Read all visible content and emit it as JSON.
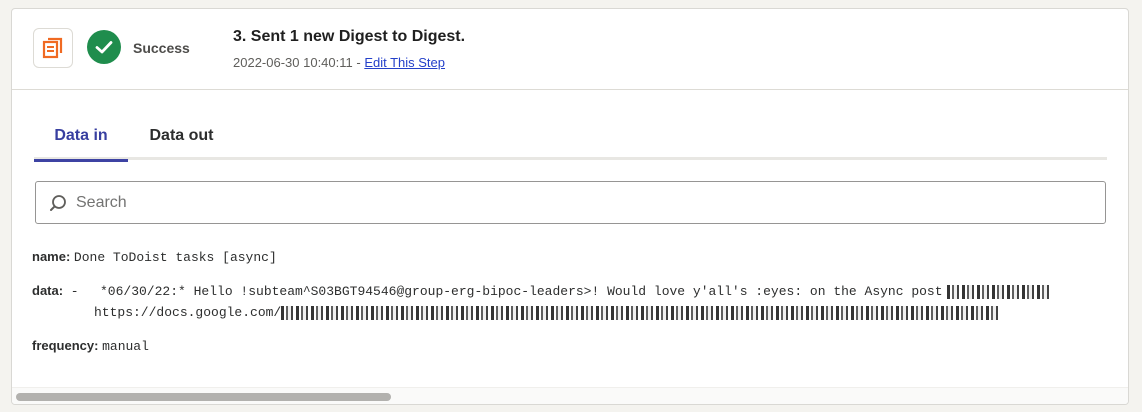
{
  "step": {
    "app_icon": "stack-pages-icon",
    "status": "Success",
    "status_icon": "check-circle-icon",
    "status_color": "#1f8d4d",
    "title": "3. Sent 1 new Digest to Digest.",
    "timestamp": "2022-06-30 10:40:11",
    "separator": " - ",
    "edit_link": "Edit This Step"
  },
  "tabs": [
    {
      "label": "Data in",
      "active": true
    },
    {
      "label": "Data out",
      "active": false
    }
  ],
  "search": {
    "placeholder": "Search",
    "value": "",
    "icon": "search-icon"
  },
  "fields": {
    "name": {
      "key": "name:",
      "value": "Done ToDoist tasks [async]"
    },
    "data": {
      "key": "data:",
      "bullet": "-",
      "line1": "*06/30/22:* Hello !subteam^S03BGT94546@group-erg-bipoc-leaders>! Would love y'all's :eyes: on the Async post",
      "line2": "https://docs.google.com/"
    },
    "frequency": {
      "key": "frequency:",
      "value": "manual"
    }
  },
  "colors": {
    "accent": "#3d43a3",
    "link": "#2440c9",
    "success": "#1f8d4d",
    "app_orange": "#f06a22"
  }
}
